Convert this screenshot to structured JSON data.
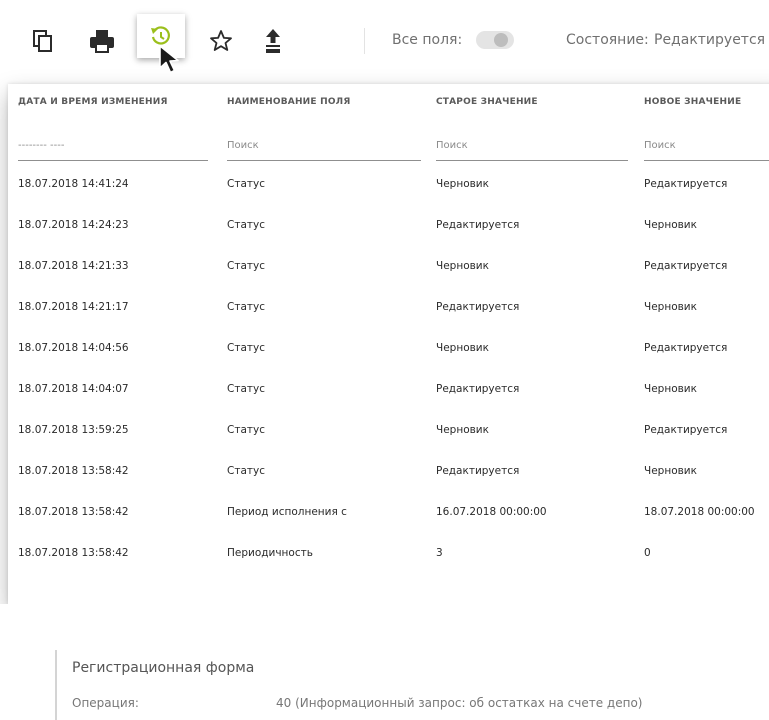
{
  "toolbar": {
    "icons": [
      "copy-icon",
      "print-icon",
      "history-icon",
      "star-icon",
      "export-xml-icon"
    ],
    "all_fields_label": "Все поля:",
    "state_label": "Состояние:",
    "state_value": "Редактируется"
  },
  "history": {
    "columns": [
      "ДАТА И ВРЕМЯ ИЗМЕНЕНИЯ",
      "НАИМЕНОВАНИЕ ПОЛЯ",
      "СТАРОЕ ЗНАЧЕНИЕ",
      "НОВОЕ ЗНАЧЕНИЕ"
    ],
    "filters": [
      "-------- ----",
      "Поиск",
      "Поиск",
      "Поиск"
    ],
    "rows": [
      [
        "18.07.2018 14:41:24",
        "Статус",
        "Черновик",
        "Редактируется"
      ],
      [
        "18.07.2018 14:24:23",
        "Статус",
        "Редактируется",
        "Черновик"
      ],
      [
        "18.07.2018 14:21:33",
        "Статус",
        "Черновик",
        "Редактируется"
      ],
      [
        "18.07.2018 14:21:17",
        "Статус",
        "Редактируется",
        "Черновик"
      ],
      [
        "18.07.2018 14:04:56",
        "Статус",
        "Черновик",
        "Редактируется"
      ],
      [
        "18.07.2018 14:04:07",
        "Статус",
        "Редактируется",
        "Черновик"
      ],
      [
        "18.07.2018 13:59:25",
        "Статус",
        "Черновик",
        "Редактируется"
      ],
      [
        "18.07.2018 13:58:42",
        "Статус",
        "Редактируется",
        "Черновик"
      ],
      [
        "18.07.2018 13:58:42",
        "Период исполнения с",
        "16.07.2018 00:00:00",
        "18.07.2018 00:00:00"
      ],
      [
        "18.07.2018 13:58:42",
        "Периодичность",
        "3",
        "0"
      ]
    ]
  },
  "form": {
    "title": "Регистрационная форма",
    "operation_label": "Операция:",
    "operation_value": "40 (Информационный запрос: об остатках на счете депо)"
  },
  "colors": {
    "history_icon": "#9bbf1c",
    "icon_dark": "#2b2b2b"
  }
}
